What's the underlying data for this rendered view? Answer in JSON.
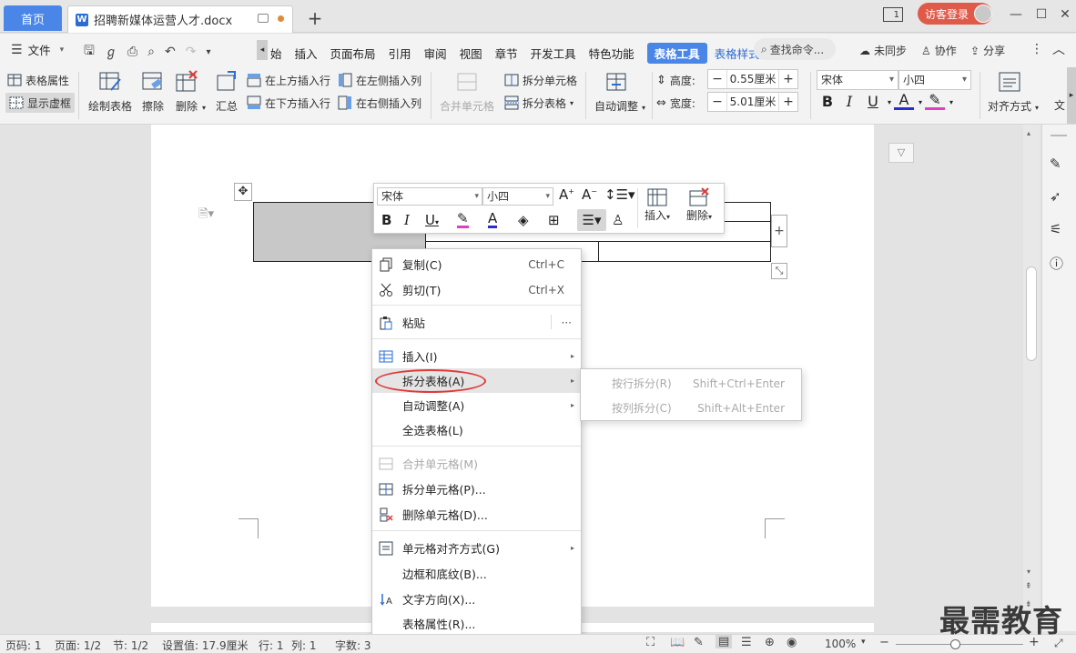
{
  "tabs": {
    "home": "首页",
    "document": "招聘新媒体运营人才.docx",
    "new_tab": "+"
  },
  "window": {
    "login": "访客登录",
    "restore": "1"
  },
  "menubar": {
    "file": "文件",
    "items": [
      "始",
      "插入",
      "页面布局",
      "引用",
      "审阅",
      "视图",
      "章节",
      "开发工具",
      "特色功能"
    ],
    "table_tools": "表格工具",
    "table_style": "表格样式",
    "search": "查找命令...",
    "sync": "未同步",
    "collab": "协作",
    "share": "分享"
  },
  "ribbon": {
    "table_props": "表格属性",
    "show_grid": "显示虚框",
    "draw_table": "绘制表格",
    "erase": "擦除",
    "delete": "删除",
    "summary": "汇总",
    "insert_above": "在上方插入行",
    "insert_below": "在下方插入行",
    "insert_left": "在左侧插入列",
    "insert_right": "在右侧插入列",
    "merge_cells": "合并单元格",
    "split_cells": "拆分单元格",
    "split_table": "拆分表格",
    "auto_fit": "自动调整",
    "height_label": "高度:",
    "height_value": "0.55厘米",
    "width_label": "宽度:",
    "width_value": "5.01厘米",
    "font": "宋体",
    "font_size": "小四",
    "align": "对齐方式",
    "text_dir": "文"
  },
  "minitoolbar": {
    "font": "宋体",
    "size": "小四",
    "insert": "插入",
    "delete": "删除"
  },
  "context_menu": {
    "copy": "复制(C)",
    "copy_sc": "Ctrl+C",
    "cut": "剪切(T)",
    "cut_sc": "Ctrl+X",
    "paste": "粘贴",
    "paste_more": "···",
    "insert": "插入(I)",
    "split_table": "拆分表格(A)",
    "auto_fit": "自动调整(A)",
    "select_table": "全选表格(L)",
    "merge_cells": "合并单元格(M)",
    "split_cells": "拆分单元格(P)...",
    "delete_cells": "删除单元格(D)...",
    "cell_align": "单元格对齐方式(G)",
    "borders": "边框和底纹(B)...",
    "text_dir": "文字方向(X)...",
    "table_props": "表格属性(R)..."
  },
  "submenu": {
    "by_row": "按行拆分(R)",
    "by_row_sc": "Shift+Ctrl+Enter",
    "by_col": "按列拆分(C)",
    "by_col_sc": "Shift+Alt+Enter"
  },
  "statusbar": {
    "page": "页码: 1",
    "pages": "页面: 1/2",
    "section": "节: 1/2",
    "setting": "设置值: 17.9厘米",
    "row": "行: 1",
    "col": "列: 1",
    "words": "字数: 3",
    "zoom": "100%"
  },
  "watermark": "最需教育",
  "colors": {
    "accent": "#4a86e8",
    "login": "#e05a4a",
    "highlight": "#e03a3a"
  }
}
